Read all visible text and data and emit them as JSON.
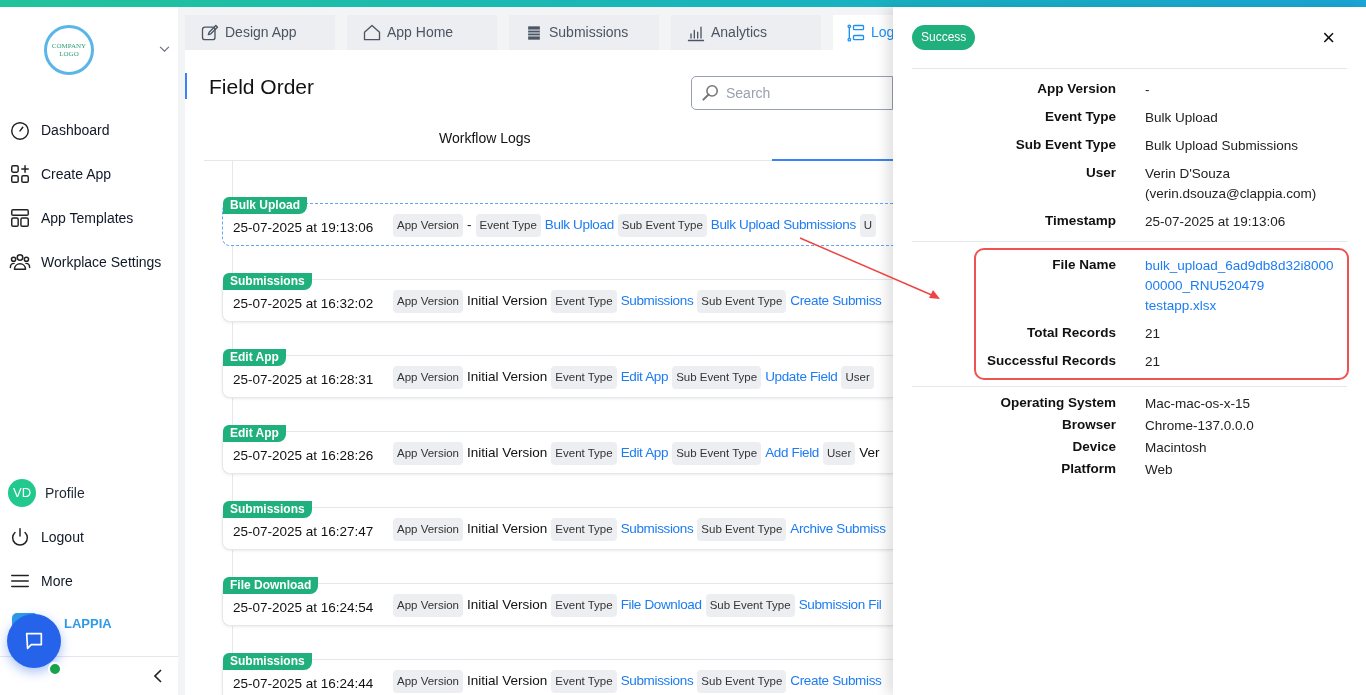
{
  "sidebar": {
    "logo_text": "COMPANY LOGO",
    "nav": [
      {
        "label": "Dashboard"
      },
      {
        "label": "Create App"
      },
      {
        "label": "App Templates"
      },
      {
        "label": "Workplace Settings"
      }
    ],
    "profile": {
      "initials": "VD",
      "label": "Profile"
    },
    "bottom": [
      {
        "label": "Logout"
      },
      {
        "label": "More"
      }
    ],
    "brand": "LAPPIA"
  },
  "tabs": [
    {
      "label": "Design App",
      "selected": false
    },
    {
      "label": "App Home",
      "selected": false
    },
    {
      "label": "Submissions",
      "selected": false
    },
    {
      "label": "Analytics",
      "selected": false
    },
    {
      "label": "Log",
      "selected": true
    }
  ],
  "page_title": "Field Order",
  "search": {
    "placeholder": "Search"
  },
  "sub_tab": "Workflow Logs",
  "logs": [
    {
      "badge": "Bulk Upload",
      "time": "25-07-2025 at 19:13:06",
      "selected": true,
      "items": [
        {
          "kind": "label",
          "text": "App Version"
        },
        {
          "kind": "value",
          "text": "-"
        },
        {
          "kind": "label",
          "text": "Event Type"
        },
        {
          "kind": "link",
          "text": "Bulk Upload"
        },
        {
          "kind": "label",
          "text": "Sub Event Type"
        },
        {
          "kind": "link",
          "text": "Bulk Upload Submissions"
        },
        {
          "kind": "label",
          "text": "U"
        }
      ]
    },
    {
      "badge": "Submissions",
      "time": "25-07-2025 at 16:32:02",
      "selected": false,
      "items": [
        {
          "kind": "label",
          "text": "App Version"
        },
        {
          "kind": "value",
          "text": "Initial Version"
        },
        {
          "kind": "label",
          "text": "Event Type"
        },
        {
          "kind": "link",
          "text": "Submissions"
        },
        {
          "kind": "label",
          "text": "Sub Event Type"
        },
        {
          "kind": "link",
          "text": "Create Submiss"
        }
      ]
    },
    {
      "badge": "Edit App",
      "time": "25-07-2025 at 16:28:31",
      "selected": false,
      "items": [
        {
          "kind": "label",
          "text": "App Version"
        },
        {
          "kind": "value",
          "text": "Initial Version"
        },
        {
          "kind": "label",
          "text": "Event Type"
        },
        {
          "kind": "link",
          "text": "Edit App"
        },
        {
          "kind": "label",
          "text": "Sub Event Type"
        },
        {
          "kind": "link",
          "text": "Update Field"
        },
        {
          "kind": "label",
          "text": "User"
        }
      ]
    },
    {
      "badge": "Edit App",
      "time": "25-07-2025 at 16:28:26",
      "selected": false,
      "items": [
        {
          "kind": "label",
          "text": "App Version"
        },
        {
          "kind": "value",
          "text": "Initial Version"
        },
        {
          "kind": "label",
          "text": "Event Type"
        },
        {
          "kind": "link",
          "text": "Edit App"
        },
        {
          "kind": "label",
          "text": "Sub Event Type"
        },
        {
          "kind": "link",
          "text": "Add Field"
        },
        {
          "kind": "label",
          "text": "User"
        },
        {
          "kind": "value",
          "text": "Ver"
        }
      ]
    },
    {
      "badge": "Submissions",
      "time": "25-07-2025 at 16:27:47",
      "selected": false,
      "items": [
        {
          "kind": "label",
          "text": "App Version"
        },
        {
          "kind": "value",
          "text": "Initial Version"
        },
        {
          "kind": "label",
          "text": "Event Type"
        },
        {
          "kind": "link",
          "text": "Submissions"
        },
        {
          "kind": "label",
          "text": "Sub Event Type"
        },
        {
          "kind": "link",
          "text": "Archive Submiss"
        }
      ]
    },
    {
      "badge": "File Download",
      "time": "25-07-2025 at 16:24:54",
      "selected": false,
      "items": [
        {
          "kind": "label",
          "text": "App Version"
        },
        {
          "kind": "value",
          "text": "Initial Version"
        },
        {
          "kind": "label",
          "text": "Event Type"
        },
        {
          "kind": "link",
          "text": "File Download"
        },
        {
          "kind": "label",
          "text": "Sub Event Type"
        },
        {
          "kind": "link",
          "text": "Submission Fil"
        }
      ]
    },
    {
      "badge": "Submissions",
      "time": "25-07-2025 at 16:24:44",
      "selected": false,
      "items": [
        {
          "kind": "label",
          "text": "App Version"
        },
        {
          "kind": "value",
          "text": "Initial Version"
        },
        {
          "kind": "label",
          "text": "Event Type"
        },
        {
          "kind": "link",
          "text": "Submissions"
        },
        {
          "kind": "label",
          "text": "Sub Event Type"
        },
        {
          "kind": "link",
          "text": "Create Submiss"
        }
      ]
    }
  ],
  "detail": {
    "status": "Success",
    "close": "×",
    "groups": [
      {
        "highlighted": false,
        "rows": [
          {
            "label": "App Version",
            "kind": "text",
            "lines": [
              "-"
            ]
          },
          {
            "label": "Event Type",
            "kind": "text",
            "lines": [
              "Bulk Upload"
            ]
          },
          {
            "label": "Sub Event Type",
            "kind": "text",
            "lines": [
              "Bulk Upload Submissions"
            ]
          },
          {
            "label": "User",
            "kind": "text",
            "lines": [
              "Verin D'Souza",
              "(verin.dsouza@clappia.com)"
            ]
          },
          {
            "label": "Timestamp",
            "kind": "text",
            "lines": [
              "25-07-2025 at 19:13:06"
            ]
          }
        ]
      },
      {
        "highlighted": true,
        "rows": [
          {
            "label": "File Name",
            "kind": "link",
            "lines": [
              "bulk_upload_6ad9db8d32i8000",
              "00000_RNU520479",
              "testapp.xlsx"
            ]
          },
          {
            "label": "Total Records",
            "kind": "text",
            "lines": [
              "21"
            ]
          },
          {
            "label": "Successful Records",
            "kind": "text",
            "lines": [
              "21"
            ]
          }
        ]
      },
      {
        "highlighted": false,
        "rows": [
          {
            "label": "Operating System",
            "kind": "text",
            "lines": [
              "Mac-mac-os-x-15"
            ]
          },
          {
            "label": "Browser",
            "kind": "text",
            "lines": [
              "Chrome-137.0.0.0"
            ]
          },
          {
            "label": "Device",
            "kind": "text",
            "lines": [
              "Macintosh"
            ]
          },
          {
            "label": "Platform",
            "kind": "text",
            "lines": [
              "Web"
            ]
          }
        ]
      }
    ]
  }
}
